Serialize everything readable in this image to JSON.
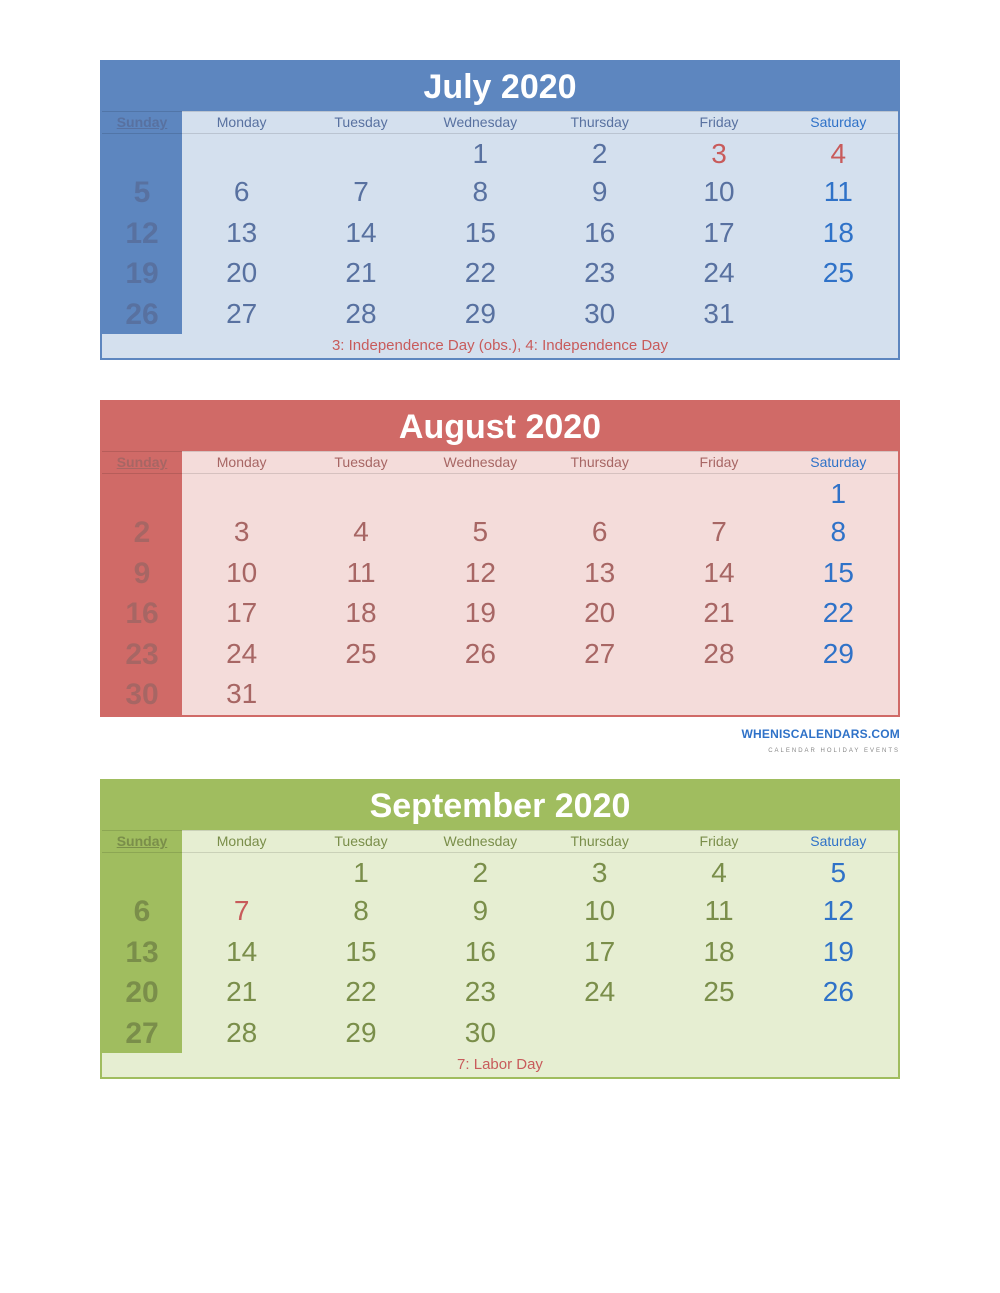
{
  "dow": [
    "Sunday",
    "Monday",
    "Tuesday",
    "Wednesday",
    "Thursday",
    "Friday",
    "Saturday"
  ],
  "months": [
    {
      "key": "july",
      "title": "July 2020",
      "weeks": [
        [
          "",
          "",
          "",
          "1",
          "2",
          "3",
          "4"
        ],
        [
          "5",
          "6",
          "7",
          "8",
          "9",
          "10",
          "11"
        ],
        [
          "12",
          "13",
          "14",
          "15",
          "16",
          "17",
          "18"
        ],
        [
          "19",
          "20",
          "21",
          "22",
          "23",
          "24",
          "25"
        ],
        [
          "26",
          "27",
          "28",
          "29",
          "30",
          "31",
          ""
        ]
      ],
      "holidays_text": "3: Independence Day (obs.), 4: Independence Day",
      "holiday_cells": [
        "3",
        "4"
      ]
    },
    {
      "key": "august",
      "title": "August 2020",
      "weeks": [
        [
          "",
          "",
          "",
          "",
          "",
          "",
          "1"
        ],
        [
          "2",
          "3",
          "4",
          "5",
          "6",
          "7",
          "8"
        ],
        [
          "9",
          "10",
          "11",
          "12",
          "13",
          "14",
          "15"
        ],
        [
          "16",
          "17",
          "18",
          "19",
          "20",
          "21",
          "22"
        ],
        [
          "23",
          "24",
          "25",
          "26",
          "27",
          "28",
          "29"
        ],
        [
          "30",
          "31",
          "",
          "",
          "",
          "",
          ""
        ]
      ],
      "holidays_text": "",
      "holiday_cells": []
    },
    {
      "key": "september",
      "title": "September 2020",
      "weeks": [
        [
          "",
          "",
          "1",
          "2",
          "3",
          "4",
          "5"
        ],
        [
          "6",
          "7",
          "8",
          "9",
          "10",
          "11",
          "12"
        ],
        [
          "13",
          "14",
          "15",
          "16",
          "17",
          "18",
          "19"
        ],
        [
          "20",
          "21",
          "22",
          "23",
          "24",
          "25",
          "26"
        ],
        [
          "27",
          "28",
          "29",
          "30",
          "",
          "",
          ""
        ]
      ],
      "holidays_text": "7: Labor Day",
      "holiday_cells": [
        "7"
      ]
    }
  ],
  "watermark": "WHENISCALENDARS.COM",
  "watermark_sub": "CALENDAR   HOLIDAY   EVENTS"
}
